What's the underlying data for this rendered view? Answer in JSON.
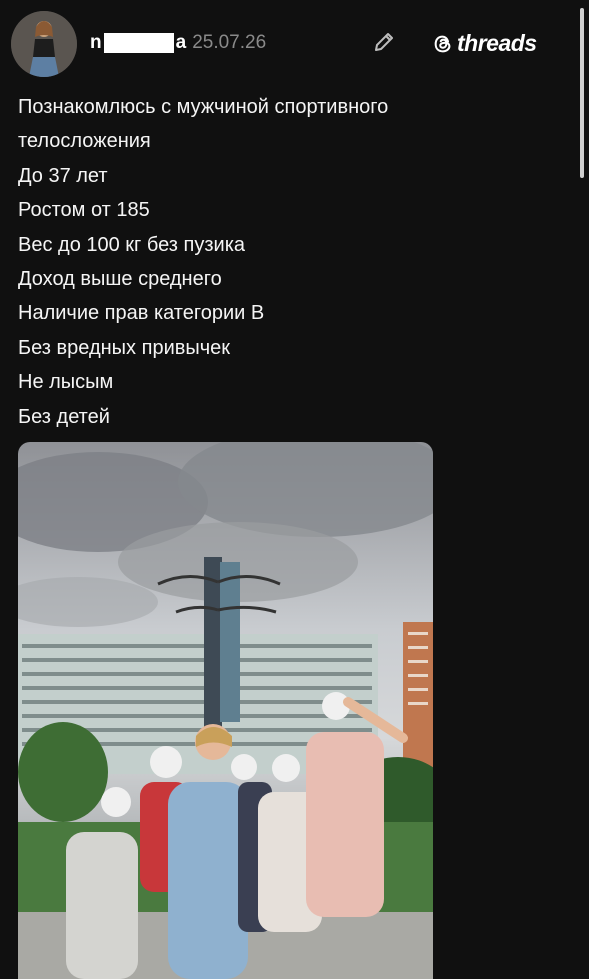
{
  "post": {
    "author": {
      "name_start": "n",
      "name_end": "a",
      "date": "25.07.26"
    },
    "app": {
      "brand": "threads",
      "logo_icon": "threads-logo-icon",
      "edit_icon": "pencil-icon"
    },
    "lines": [
      "Познакомлюсь с мужчиной спортивного",
      "телосложения",
      "До 37 лет",
      "Ростом от 185",
      "Вес до 100 кг без пузика",
      "Доход выше среднего",
      "Наличие прав категории В",
      "Без вредных привычек",
      "Не лысым",
      "Без детей"
    ]
  },
  "colors": {
    "background": "#101010",
    "text": "#f5f5f5",
    "date": "#8a8a8a"
  }
}
